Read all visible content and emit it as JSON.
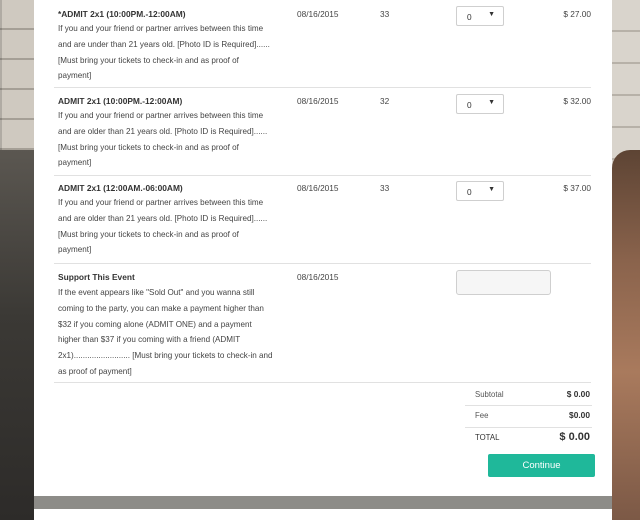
{
  "tickets": [
    {
      "title": "*ADMIT 2x1 (10:00PM.-12:00AM)",
      "desc_lines": [
        "If you and your friend or partner arrives between this time",
        "and are under than 21 years old. [Photo ID is Required]......",
        "[Must bring your tickets to check-in and as proof of",
        "payment]"
      ],
      "date": "08/16/2015",
      "available": "33",
      "qty": "0",
      "price": "$ 27.00"
    },
    {
      "title": "ADMIT 2x1 (10:00PM.-12:00AM)",
      "desc_lines": [
        "If you and your friend or partner arrives between this time",
        "and are older than 21 years old. [Photo ID is Required]......",
        "[Must bring your tickets to check-in and as proof of",
        "payment]"
      ],
      "date": "08/16/2015",
      "available": "32",
      "qty": "0",
      "price": "$ 32.00"
    },
    {
      "title": "ADMIT 2x1 (12:00AM.-06:00AM)",
      "desc_lines": [
        "If you and your friend or partner arrives between this time",
        "and are older than 21 years old. [Photo ID is Required]......",
        "[Must bring your tickets to check-in and as proof of",
        "payment]"
      ],
      "date": "08/16/2015",
      "available": "33",
      "qty": "0",
      "price": "$ 37.00"
    }
  ],
  "support": {
    "title": "Support This Event",
    "desc_lines": [
      "If the event appears like \"Sold Out\" and you wanna still",
      "coming to the party, you can make a payment higher than",
      "$32 if you coming alone (ADMIT ONE) and a payment",
      "higher than $37 if you coming with a friend (ADMIT",
      "2x1)......................... [Must bring your tickets to check-in and",
      "as proof of payment]"
    ],
    "date": "08/16/2015",
    "amount": ""
  },
  "totals": {
    "subtotal_label": "Subtotal",
    "subtotal_value": "$ 0.00",
    "fee_label": "Fee",
    "fee_value": "$0.00",
    "total_label": "TOTAL",
    "total_value": "$ 0.00"
  },
  "continue_label": "Continue",
  "colors": {
    "accent": "#1fb89a"
  },
  "icons": {
    "select_caret": "chevron-down-icon"
  }
}
